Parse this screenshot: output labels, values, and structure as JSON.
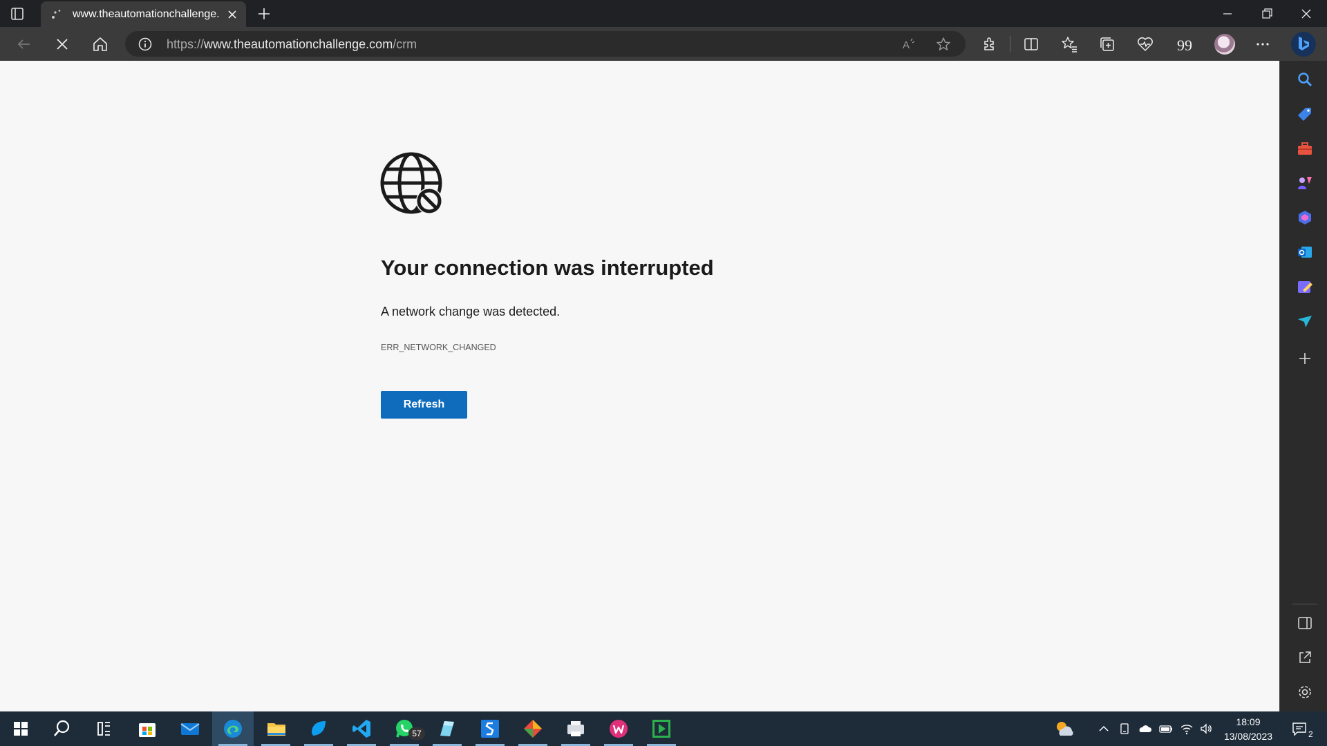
{
  "browser": {
    "tab": {
      "title": "www.theautomationchallenge.co",
      "state": "loading"
    },
    "address_bar": {
      "url_prefix": "https://",
      "url_host": "www.theautomationchallenge.com",
      "url_path": "/crm"
    },
    "toolbar_icons": [
      "back-icon",
      "stop-loading-icon",
      "home-icon",
      "read-aloud-icon",
      "favorite-star-icon",
      "extensions-icon",
      "split-screen-icon",
      "favorites-icon",
      "collections-icon",
      "browser-essentials-icon",
      "quote-icon",
      "profile-avatar",
      "more-menu-icon",
      "copilot-icon"
    ]
  },
  "error_page": {
    "icon": "globe-blocked-icon",
    "title": "Your connection was interrupted",
    "description": "A network change was detected.",
    "error_code": "ERR_NETWORK_CHANGED",
    "refresh_label": "Refresh"
  },
  "sidebar": {
    "items": [
      "search-icon",
      "shopping-icon",
      "tools-icon",
      "games-icon",
      "microsoft-365-icon",
      "outlook-icon",
      "drop-icon",
      "designer-icon",
      "add-icon"
    ],
    "footer": [
      "hide-sidebar-icon",
      "open-external-icon",
      "settings-icon"
    ]
  },
  "taskbar": {
    "apps": [
      "start-icon",
      "search-icon",
      "task-view-icon",
      "store-icon",
      "mail-icon",
      "edge-icon",
      "file-explorer-icon",
      "app-icon",
      "vscode-icon",
      "whatsapp-icon",
      "app-icon",
      "app-icon",
      "git-icon",
      "app-icon",
      "app-icon",
      "app-icon"
    ],
    "whatsapp_badge": "57",
    "clock": {
      "time": "18:09",
      "date": "13/08/2023"
    },
    "notification_count": "2"
  },
  "colors": {
    "accent": "#0f6cbd",
    "titlebar": "#202124",
    "toolbar": "#3b3b3b",
    "page": "#f7f7f7",
    "taskbar": "#1e2c3a"
  }
}
